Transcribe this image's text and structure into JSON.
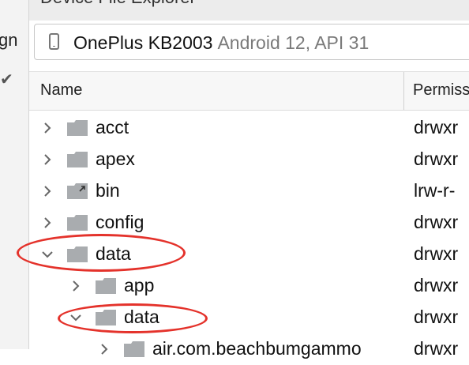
{
  "left": {
    "label": "gn",
    "check": "✔"
  },
  "panel": {
    "title": "Device File Explorer"
  },
  "device": {
    "name": "OnePlus KB2003",
    "detail": "Android 12, API 31"
  },
  "table": {
    "col_name": "Name",
    "col_perm": "Permiss"
  },
  "rows": [
    {
      "name": "acct",
      "perm": "drwxr",
      "expanded": false,
      "level": 0
    },
    {
      "name": "apex",
      "perm": "drwxr",
      "expanded": false,
      "level": 0
    },
    {
      "name": "bin",
      "perm": "lrw-r-",
      "expanded": false,
      "level": 0,
      "symlink": true
    },
    {
      "name": "config",
      "perm": "drwxr",
      "expanded": false,
      "level": 0
    },
    {
      "name": "data",
      "perm": "drwxr",
      "expanded": true,
      "level": 0
    },
    {
      "name": "app",
      "perm": "drwxr",
      "expanded": false,
      "level": 1
    },
    {
      "name": "data",
      "perm": "drwxr",
      "expanded": true,
      "level": 1
    },
    {
      "name": "air.com.beachbumgammo",
      "perm": "drwxr",
      "expanded": false,
      "level": 2
    }
  ],
  "colors": {
    "folder": "#a9acaf",
    "annotation": "#e4322b",
    "chevron": "#666666"
  }
}
